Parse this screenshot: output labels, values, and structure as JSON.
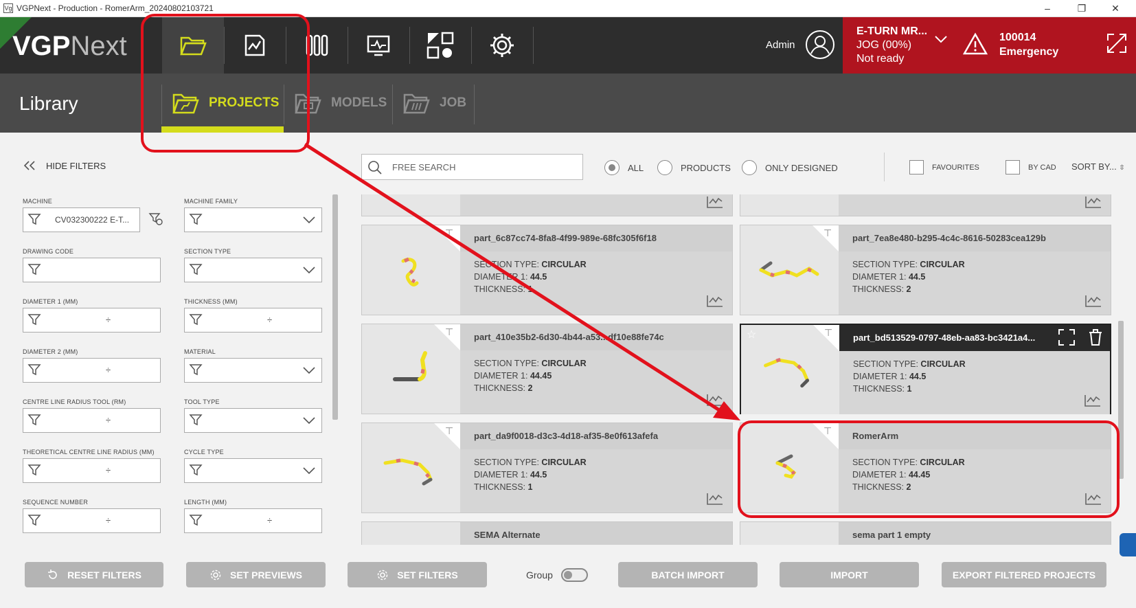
{
  "window": {
    "title": "VGPNext - Production - RomerArm_20240802103721",
    "app_icon": "Vg"
  },
  "logo": {
    "bold": "VGP",
    "light": "Next"
  },
  "nav": {
    "items": [
      "folder-icon",
      "edit-drawing-icon",
      "tools-icon",
      "monitor-icon",
      "shapes-icon",
      "gear-icon"
    ],
    "active": 0
  },
  "user": {
    "name": "Admin"
  },
  "alarm": {
    "machine": "E-TURN MR...",
    "jog": "JOG (00%)",
    "state": "Not ready",
    "code": "100014",
    "message": "Emergency",
    "color": "#b0141f"
  },
  "subheader": {
    "title": "Library",
    "tabs": [
      {
        "label": "PROJECTS",
        "active": true
      },
      {
        "label": "MODELS",
        "active": false
      },
      {
        "label": "JOB",
        "active": false
      }
    ],
    "accent": "#d4dc1c"
  },
  "toolbar": {
    "hide_filters": "HIDE FILTERS",
    "search_placeholder": "FREE SEARCH",
    "radios": [
      {
        "label": "ALL",
        "selected": true
      },
      {
        "label": "PRODUCTS",
        "selected": false
      },
      {
        "label": "ONLY DESIGNED",
        "selected": false
      }
    ],
    "favourites": "FAVOURITES",
    "by_cad": "BY CAD",
    "sort": "SORT BY..."
  },
  "filters": {
    "machine": {
      "label": "MACHINE",
      "value": "CV032300222 E-T..."
    },
    "machine_family": {
      "label": "MACHINE FAMILY"
    },
    "drawing_code": {
      "label": "DRAWING CODE"
    },
    "section_type": {
      "label": "SECTION TYPE"
    },
    "diameter1": {
      "label": "DIAMETER 1 (MM)",
      "sep": "÷"
    },
    "thickness": {
      "label": "THICKNESS (MM)",
      "sep": "÷"
    },
    "diameter2": {
      "label": "DIAMETER 2 (MM)",
      "sep": "÷"
    },
    "material": {
      "label": "MATERIAL"
    },
    "clr_tool": {
      "label": "CENTRE LINE RADIUS TOOL (RM)",
      "sep": "÷"
    },
    "tool_type": {
      "label": "TOOL TYPE"
    },
    "theo_clr": {
      "label": "THEORETICAL CENTRE LINE RADIUS (MM)",
      "sep": "÷"
    },
    "cycle_type": {
      "label": "CYCLE TYPE"
    },
    "sequence": {
      "label": "SEQUENCE NUMBER",
      "sep": "÷"
    },
    "length": {
      "label": "LENGTH (MM)",
      "sep": "÷"
    }
  },
  "labels": {
    "section": "SECTION TYPE:",
    "diam": "DIAMETER 1:",
    "thick": "THICKNESS:"
  },
  "cards": [
    {
      "name": "part_6c87cc74-8fa8-4f99-989e-68fc305f6f18",
      "section": "CIRCULAR",
      "diameter": "44.5",
      "thickness": "1"
    },
    {
      "name": "part_7ea8e480-b295-4c4c-8616-50283cea129b",
      "section": "CIRCULAR",
      "diameter": "44.5",
      "thickness": "2"
    },
    {
      "name": "part_410e35b2-6d30-4b44-a53...df10e88fe74c",
      "section": "CIRCULAR",
      "diameter": "44.45",
      "thickness": "2"
    },
    {
      "name": "part_bd513529-0797-48eb-aa83-bc3421a4...",
      "section": "CIRCULAR",
      "diameter": "44.5",
      "thickness": "1"
    },
    {
      "name": "part_da9f0018-d3c3-4d18-af35-8e0f613afefa",
      "section": "CIRCULAR",
      "diameter": "44.5",
      "thickness": "1"
    },
    {
      "name": "RomerArm",
      "section": "CIRCULAR",
      "diameter": "44.45",
      "thickness": "2"
    },
    {
      "name": "SEMA Alternate"
    },
    {
      "name": "sema part 1 empty"
    }
  ],
  "bottom": {
    "reset": "RESET FILTERS",
    "previews": "SET PREVIEWS",
    "set_filters": "SET FILTERS",
    "group": "Group",
    "batch": "BATCH IMPORT",
    "import": "IMPORT",
    "export": "EXPORT FILTERED PROJECTS"
  },
  "annotation_color": "#e2111c"
}
